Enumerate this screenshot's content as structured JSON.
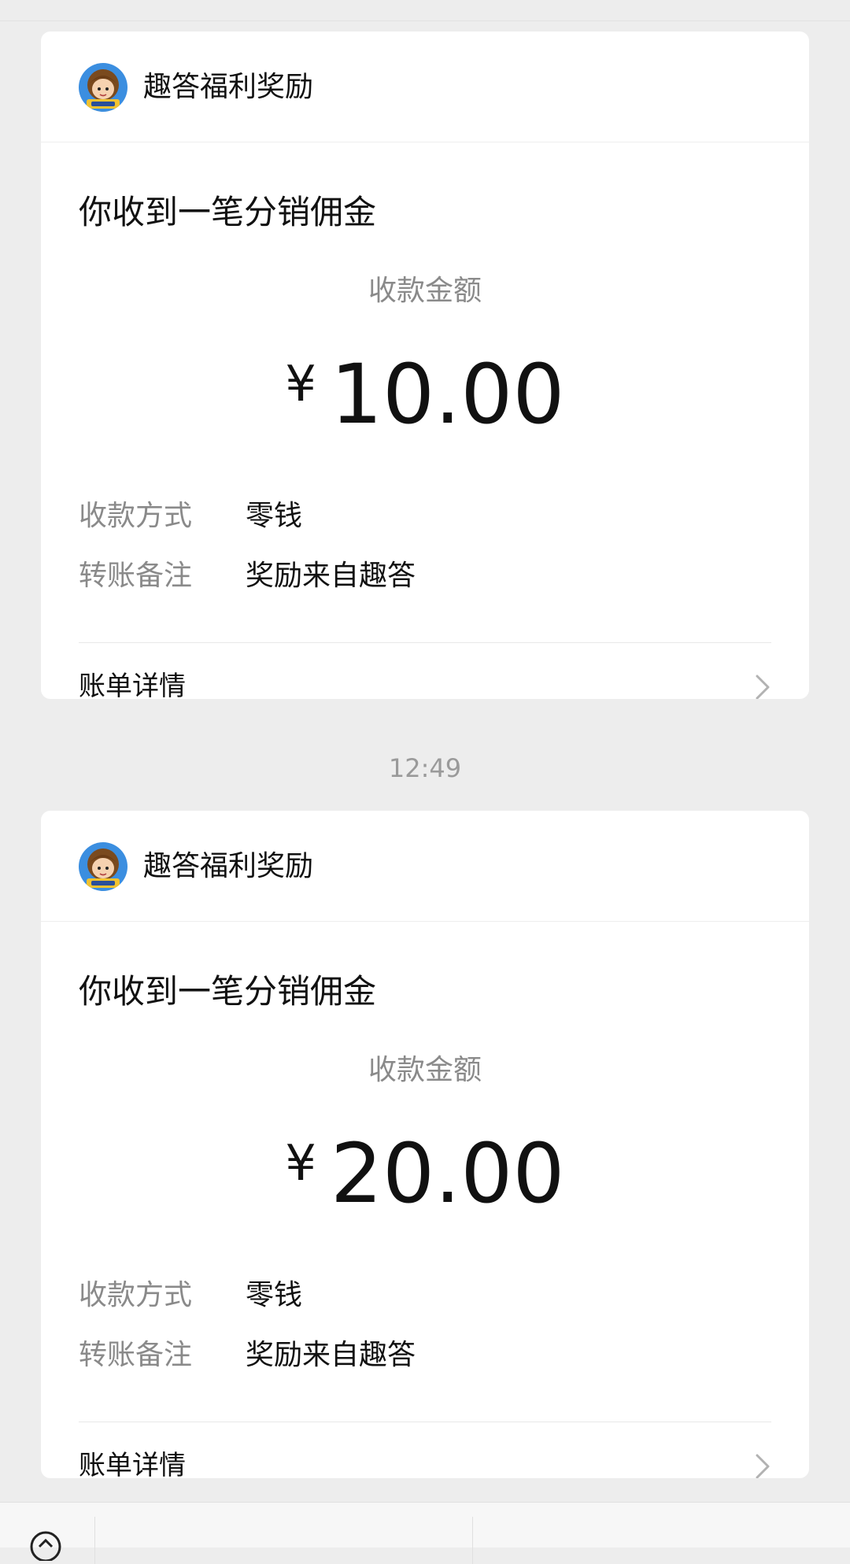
{
  "messages": [
    {
      "sender": "趣答福利奖励",
      "title": "你收到一笔分销佣金",
      "amount_label": "收款金额",
      "currency": "¥",
      "amount": "10.00",
      "rows": [
        {
          "key": "收款方式",
          "value": "零钱"
        },
        {
          "key": "转账备注",
          "value": "奖励来自趣答"
        }
      ],
      "detail_label": "账单详情"
    },
    {
      "sender": "趣答福利奖励",
      "title": "你收到一笔分销佣金",
      "amount_label": "收款金额",
      "currency": "¥",
      "amount": "20.00",
      "rows": [
        {
          "key": "收款方式",
          "value": "零钱"
        },
        {
          "key": "转账备注",
          "value": "奖励来自趣答"
        }
      ],
      "detail_label": "账单详情"
    }
  ],
  "timestamp": "12:49",
  "icons": {
    "avatar": "cartoon-avatar-icon",
    "chevron": "chevron-right-icon",
    "bottom": "service-icon"
  },
  "colors": {
    "background": "#ededed",
    "card": "#ffffff",
    "muted_text": "#8a8a8a"
  }
}
